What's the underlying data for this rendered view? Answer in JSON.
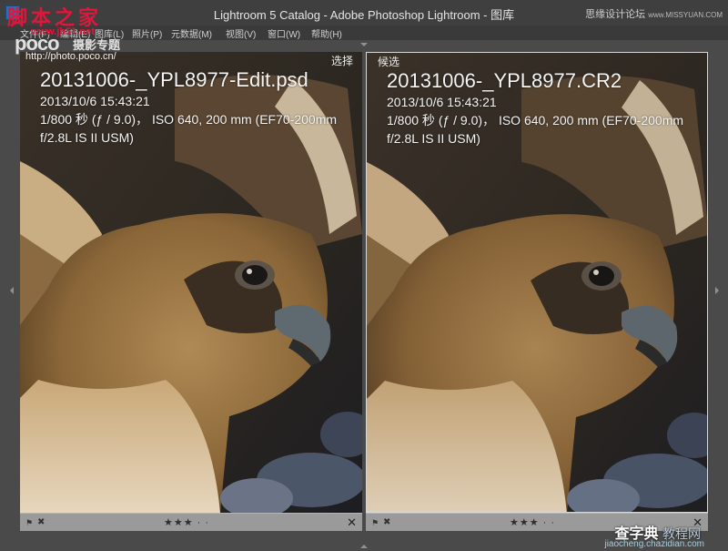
{
  "window": {
    "title": "Lightroom 5 Catalog - Adobe Photoshop Lightroom - 图库",
    "brand_right": "思缘设计论坛",
    "brand_right_small": "www.MISSYUAN.COM"
  },
  "menu": [
    "文件(F)",
    "编辑(E)",
    "图库(L)",
    "照片(P)",
    "元数据(M)",
    "视图(V)",
    "窗口(W)",
    "帮助(H)"
  ],
  "watermarks": {
    "site_cn": "脚本之家",
    "site_url": "www.jb51.net",
    "poco": "poco",
    "poco_sub": "摄影专题",
    "poco_url": "http://photo.poco.cn/",
    "bottom_cn": "查字典",
    "bottom_cn2": "教程网",
    "bottom_url": "jiaocheng.chazidian.com"
  },
  "panes": [
    {
      "tag": "选择",
      "filename": "20131006-_YPL8977-Edit.psd",
      "datetime": "2013/10/6 15:43:21",
      "exposure": "1/800 秒 (ƒ / 9.0)，  ISO 640, 200 mm (EF70-200mm f/2.8L IS II USM)",
      "rating": "★★★ · ·",
      "selected": false
    },
    {
      "tag": "候选",
      "filename": "20131006-_YPL8977.CR2",
      "datetime": "2013/10/6 15:43:21",
      "exposure": "1/800 秒 (ƒ / 9.0)，  ISO 640, 200 mm (EF70-200mm f/2.8L IS II USM)",
      "rating": "★★★ · ·",
      "selected": true
    }
  ],
  "icons": {
    "flag": "flag-icon",
    "reject": "reject-flag-icon",
    "close": "close-icon",
    "collapse": "triangle-icon"
  },
  "colors": {
    "watermark_red": "#e0173b",
    "frame": "#4a4a4a",
    "toolbar": "#9a9a9a"
  }
}
